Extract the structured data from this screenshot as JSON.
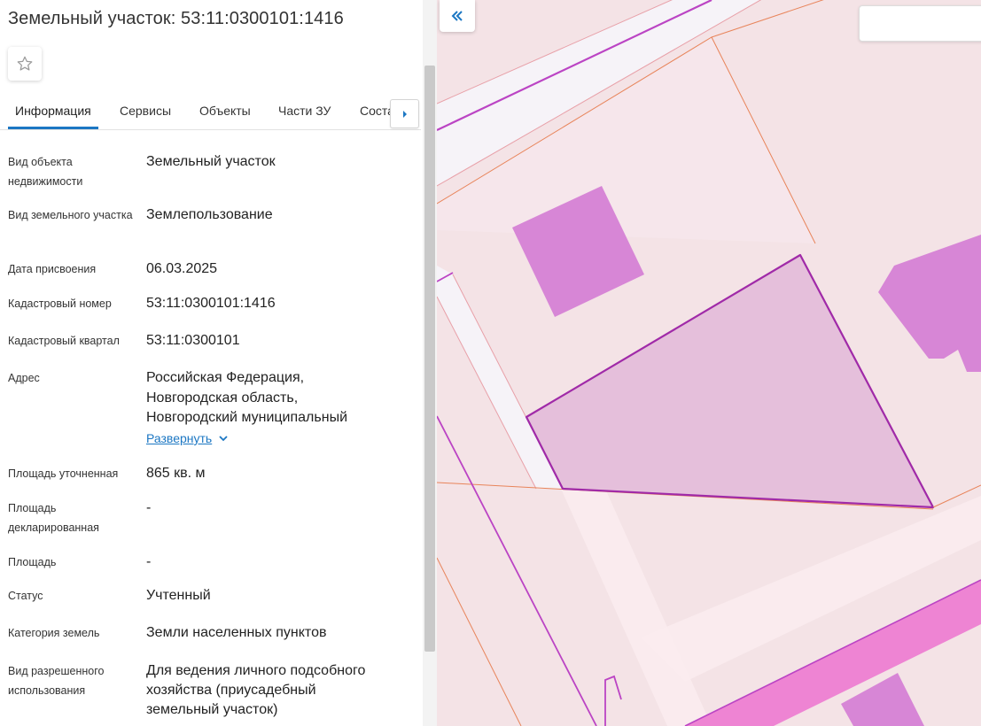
{
  "header": {
    "title": "Земельный участок: 53:11:0300101:1416"
  },
  "tabs": [
    {
      "label": "Информация"
    },
    {
      "label": "Сервисы"
    },
    {
      "label": "Объекты"
    },
    {
      "label": "Части ЗУ"
    },
    {
      "label": "Состав"
    }
  ],
  "fields": {
    "object_type": {
      "label": "Вид объекта недвижимости",
      "value": "Земельный участок"
    },
    "parcel_type": {
      "label": "Вид земельного участка",
      "value": "Землепользование"
    },
    "assign_date": {
      "label": "Дата присвоения",
      "value": "06.03.2025"
    },
    "cadastral_number": {
      "label": "Кадастровый номер",
      "value": "53:11:0300101:1416"
    },
    "cadastral_quarter": {
      "label": "Кадастровый квартал",
      "value": "53:11:0300101"
    },
    "address": {
      "label": "Адрес",
      "lines": [
        "Российская Федерация,",
        "Новгородская область,",
        "Новгородский муниципальный"
      ],
      "expand_label": "Развернуть"
    },
    "area_specified": {
      "label": "Площадь уточненная",
      "value": "865 кв. м"
    },
    "area_declared": {
      "label": "Площадь декларированная",
      "value": "-"
    },
    "area": {
      "label": "Площадь",
      "value": "-"
    },
    "status": {
      "label": "Статус",
      "value": "Учтенный"
    },
    "land_category": {
      "label": "Категория земель",
      "value": "Земли населенных пунктов"
    },
    "permitted_use": {
      "label": "Вид разрешенного использования",
      "lines": [
        "Для ведения личного подсобного",
        "хозяйства (приусадебный",
        "земельный участок)"
      ]
    }
  },
  "map": {
    "search_placeholder": "",
    "colors": {
      "background": "#f4e3e6",
      "parcel_fill": "#e5bfdb",
      "parcel_stroke": "#a02aa8",
      "building": "#d786d6",
      "road": "#f6f3f8",
      "boundary": "#e8845a",
      "highlight": "#ee84d3",
      "accent": "#1c77c3"
    }
  },
  "icons": {
    "favorite": "star-outline-icon",
    "tabs_next": "caret-right-icon",
    "expand": "chevron-down-icon",
    "collapse_panel": "double-chevron-left-icon"
  }
}
